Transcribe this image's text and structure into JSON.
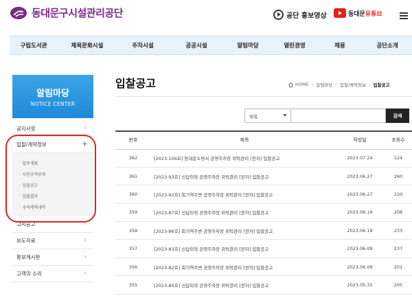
{
  "header": {
    "org_name": "동대문구시설관리공단",
    "promo_video": "공단 홍보영상",
    "youtube": {
      "prefix": "동대문",
      "suffix": "유튜브"
    },
    "colors": {
      "brand": "#7a2a8a",
      "youtube": "#e62117"
    }
  },
  "nav": {
    "items": [
      "구립도서관",
      "체육문화시설",
      "주차시설",
      "공공시설",
      "알림마당",
      "열린경영",
      "채용",
      "공단소개"
    ]
  },
  "sidebar": {
    "banner_title": "알림마당",
    "banner_subtitle": "NOTICE CENTER",
    "items": [
      {
        "label": "공지사항"
      },
      {
        "label": "입찰/계약정보",
        "expanded": true,
        "sub_items": [
          "발주계획",
          "사전규격공개",
          "입찰공고",
          "입찰결과",
          "수의계약내역"
        ]
      },
      {
        "label": "고시공고"
      },
      {
        "label": "보도자료"
      },
      {
        "label": "홍보게시판"
      },
      {
        "label": "고객의 소리"
      }
    ]
  },
  "main": {
    "title": "입찰공고",
    "breadcrumb": [
      "HOME",
      "알림마당",
      "입찰/계약정보",
      "입찰공고"
    ],
    "search": {
      "select_value": "제목",
      "input_value": "",
      "button_label": "검색"
    },
    "table": {
      "headers": {
        "no": "번호",
        "title": "제목",
        "date": "작성일",
        "views": "조회수"
      },
      "rows": [
        {
          "no": "362",
          "title": "[2023-106호] 동대문소방서 공영주차장 위탁관리 [전자] 입찰공고",
          "date": "2023.07.24",
          "views": "124"
        },
        {
          "no": "361",
          "title": "[2023-93호] 신답피혁 공영주차장 위탁관리 [전자] 입찰공고",
          "date": "2023.06.27",
          "views": "260"
        },
        {
          "no": "360",
          "title": "[2023-92호] 회기역주변 공영주차장 위탁관리 [전자] 입찰공고",
          "date": "2023.06.27",
          "views": "220"
        },
        {
          "no": "359",
          "title": "[2023-87호] 신답피혁 공영주차장 위탁관리 [전자] 입찰공고",
          "date": "2023.06.19",
          "views": "208"
        },
        {
          "no": "358",
          "title": "[2023-86호] 회기역주변 공영주차장 위탁관리 [전자] 입찰공고",
          "date": "2023.06.19",
          "views": "233"
        },
        {
          "no": "357",
          "title": "[2023-83호] 신답피혁 공영주차장 위탁관리 [전자] 입찰공고",
          "date": "2023.06.09",
          "views": "237"
        },
        {
          "no": "356",
          "title": "[2023-82호] 회기역주변 공영주차장 위탁관리 [전자] 입찰공고",
          "date": "2023.06.09",
          "views": "201"
        },
        {
          "no": "355",
          "title": "[2023-80호] 신답피혁 공영주차장 위탁관리 [전자] 입찰공고",
          "date": "2023.05.31",
          "views": "205"
        }
      ]
    }
  }
}
